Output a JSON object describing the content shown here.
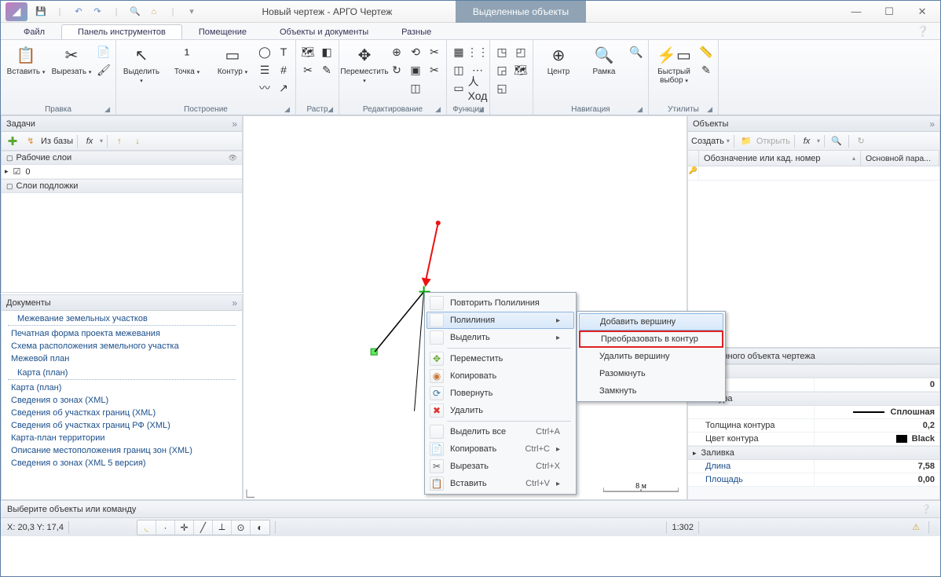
{
  "window": {
    "title": "Новый чертеж - АРГО Чертеж",
    "context_tab": "Выделенные объекты"
  },
  "qat_icons": [
    "save-icon",
    "undo-icon",
    "redo-icon",
    "zoom-extents-icon",
    "home-icon"
  ],
  "tabs": [
    "Файл",
    "Панель инструментов",
    "Помещение",
    "Объекты и документы",
    "Разные"
  ],
  "active_tab": 1,
  "ribbon": {
    "groups": [
      {
        "name": "Правка",
        "big": [
          {
            "label": "Вставить",
            "icon": "paste-icon",
            "glyph": "📋",
            "drop": true
          },
          {
            "label": "Вырезать",
            "icon": "cut-icon",
            "glyph": "✂",
            "drop": true
          }
        ],
        "stack": [
          {
            "glyph": "📄"
          },
          {
            "glyph": "🖌"
          }
        ]
      },
      {
        "name": "Построение",
        "big": [
          {
            "label": "Выделить",
            "icon": "select-icon",
            "glyph": "↖",
            "drop": true
          },
          {
            "label": "Точка",
            "icon": "point-icon",
            "glyph": "¹",
            "drop": true
          },
          {
            "label": "Контур",
            "icon": "contour-icon",
            "glyph": "▭",
            "drop": true
          }
        ],
        "stack": [
          {
            "glyph": "◯"
          },
          {
            "glyph": "☰"
          },
          {
            "glyph": "〰"
          }
        ],
        "stack2": [
          {
            "glyph": "T"
          },
          {
            "glyph": "#"
          },
          {
            "glyph": "↗"
          }
        ]
      },
      {
        "name": "Растр",
        "stack": [
          {
            "glyph": "🗺"
          },
          {
            "glyph": "✂"
          },
          {
            "glyph": ""
          }
        ],
        "stack2": [
          {
            "glyph": "◧"
          },
          {
            "glyph": "✎"
          },
          {
            "glyph": ""
          }
        ]
      },
      {
        "name": "Редактирование",
        "big": [
          {
            "label": "Переместить",
            "icon": "move-icon",
            "glyph": "✥",
            "drop": true
          }
        ],
        "stack": [
          {
            "glyph": "⊕"
          },
          {
            "glyph": "↻"
          },
          {
            "glyph": ""
          }
        ],
        "stack2": [
          {
            "glyph": "⟲"
          },
          {
            "glyph": "▣"
          },
          {
            "glyph": "◫"
          }
        ],
        "stack3": [
          {
            "glyph": "✂"
          },
          {
            "glyph": "✂"
          },
          {
            "glyph": ""
          }
        ]
      },
      {
        "name": "Функции",
        "stack": [
          {
            "glyph": "▦"
          },
          {
            "glyph": "◫"
          },
          {
            "glyph": "▭"
          }
        ],
        "stack2": [
          {
            "glyph": "⋮⋮"
          },
          {
            "glyph": "⋯"
          },
          {
            "glyph": "人  Ход"
          }
        ]
      },
      {
        "name": "",
        "stack": [
          {
            "glyph": "◳"
          },
          {
            "glyph": "◲"
          },
          {
            "glyph": "◱"
          }
        ],
        "stack2": [
          {
            "glyph": "◰"
          },
          {
            "glyph": "🗺"
          },
          {
            "glyph": ""
          }
        ]
      },
      {
        "name": "Навигация",
        "big": [
          {
            "label": "Центр",
            "icon": "center-icon",
            "glyph": "⊕"
          },
          {
            "label": "Рамка",
            "icon": "frame-icon",
            "glyph": "🔍"
          }
        ],
        "stack": [
          {
            "glyph": "🔍"
          },
          {
            "glyph": ""
          },
          {
            "glyph": ""
          }
        ]
      },
      {
        "name": "Утилиты",
        "big": [
          {
            "label": "Быстрый выбор",
            "icon": "quick-select-icon",
            "glyph": "⚡▭",
            "drop": true
          }
        ],
        "stack": [
          {
            "glyph": "📏"
          },
          {
            "glyph": "✎"
          },
          {
            "glyph": ""
          }
        ]
      }
    ]
  },
  "left": {
    "tasks_title": "Задачи",
    "tasks_toolbar": [
      {
        "g": "＋",
        "c": "#59a82e"
      },
      {
        "g": "↯",
        "c": "#d98b2e"
      },
      {
        "t": "Из базы"
      }
    ],
    "working_layers": "Рабочие слои",
    "layer_value": "0",
    "backdrop_layers": "Слои подложки",
    "documents_title": "Документы",
    "doc_groups": [
      {
        "title": "Межевание земельных участков",
        "items": [
          "Печатная форма проекта межевания",
          "Схема расположения земельного участка",
          "Межевой план"
        ]
      },
      {
        "title": "Карта (план)",
        "items": [
          "Карта (план)",
          "Сведения о зонах (XML)",
          "Сведения об участках границ (XML)",
          "Сведения об участках границ РФ (XML)",
          "Карта-план территории",
          "Описание местоположения границ зон (XML)",
          "Сведения о зонах (XML 5 версия)"
        ]
      }
    ]
  },
  "right": {
    "objects_title": "Объекты",
    "toolbar": {
      "create": "Создать",
      "open": "Открыть"
    },
    "cols": [
      "Обозначение или кад. номер",
      "Основной пара..."
    ],
    "prop_title": "выделенного объекта чертежа",
    "sections": [
      {
        "name": "ния",
        "rows": [
          [
            "",
            "0"
          ]
        ]
      },
      {
        "name": "контура",
        "rows": [
          [
            "",
            "Сплошная"
          ],
          [
            "Толщина контура",
            "0,2"
          ],
          [
            "Цвет контура",
            "Black"
          ]
        ]
      },
      {
        "name": "Заливка",
        "rows": [
          [
            "Длина",
            "7,58"
          ],
          [
            "Площадь",
            "0,00"
          ]
        ]
      }
    ]
  },
  "context_menu": {
    "items": [
      {
        "label": "Повторить Полилиния"
      },
      {
        "label": "Полилиния",
        "sub": true,
        "hover": true
      },
      {
        "label": "Выделить",
        "sub": true
      },
      {
        "sep": true
      },
      {
        "icon": "✥",
        "c": "#6a3",
        "label": "Переместить"
      },
      {
        "icon": "◉",
        "c": "#c73",
        "label": "Копировать"
      },
      {
        "icon": "⟳",
        "c": "#37a",
        "label": "Повернуть"
      },
      {
        "icon": "✖",
        "c": "#d33",
        "label": "Удалить"
      },
      {
        "sep": true
      },
      {
        "label": "Выделить все",
        "sc": "Ctrl+A"
      },
      {
        "icon": "📄",
        "label": "Копировать",
        "sc": "Ctrl+C",
        "sub": true
      },
      {
        "icon": "✂",
        "label": "Вырезать",
        "sc": "Ctrl+X"
      },
      {
        "icon": "📋",
        "label": "Вставить",
        "sc": "Ctrl+V",
        "sub": true
      }
    ],
    "sub_items": [
      {
        "label": "Добавить вершину"
      },
      {
        "label": "Преобразовать в контур",
        "red": true
      },
      {
        "label": "Удалить вершину"
      },
      {
        "label": "Разомкнуть",
        "disabled": true
      },
      {
        "label": "Замкнуть"
      }
    ]
  },
  "scale": "8 м",
  "status_line": "Выберите объекты или команду",
  "coords": "X: 20,3 Y: 17,4",
  "zoom": "1:302"
}
